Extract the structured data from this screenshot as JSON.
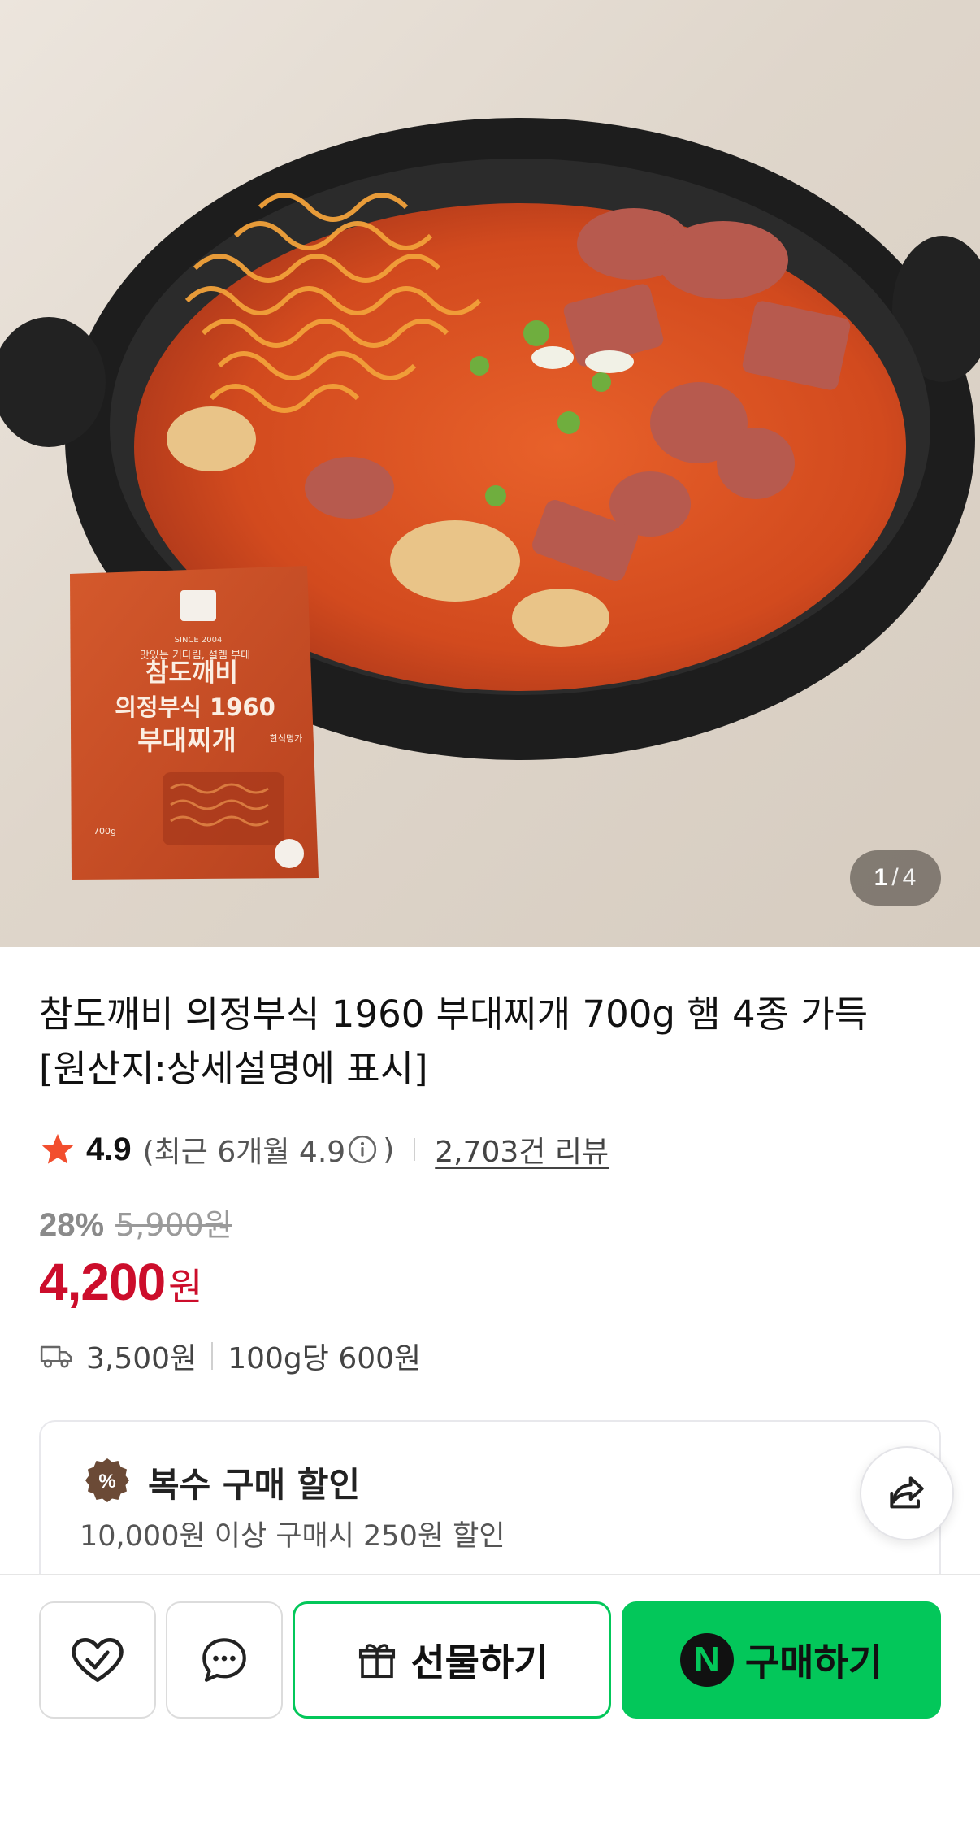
{
  "hero": {
    "page_current": "1",
    "page_separator": "/",
    "page_total": "4",
    "package": {
      "tagline": "맛있는 기다림, 설렘 부대",
      "line1": "참도깨비",
      "line2": "의정부식 1960",
      "line3": "부대찌개",
      "badge": "한식명가",
      "since": "SINCE 2004",
      "weight": "700g"
    }
  },
  "product": {
    "title": "참도깨비 의정부식 1960 부대찌개 700g 햄 4종 가득 [원산지:상세설명에 표시]",
    "rating": "4.9",
    "recent_rating": "(최근 6개월 4.9",
    "recent_rating_close": ")",
    "review_count": "2,703건 리뷰",
    "discount_rate": "28%",
    "original_price": "5,900원",
    "sale_price": "4,200",
    "currency": "원",
    "shipping_fee": "3,500원",
    "unit_price": "100g당 600원"
  },
  "promo": {
    "title": "복수 구매 할인",
    "description": "10,000원 이상 구매시 250원 할인"
  },
  "actions": {
    "gift_label": "선물하기",
    "buy_label": "구매하기",
    "naver_letter": "N"
  },
  "colors": {
    "accent_green": "#03c75a",
    "price_red": "#cc0d2b",
    "star_red": "#f24e2e"
  }
}
